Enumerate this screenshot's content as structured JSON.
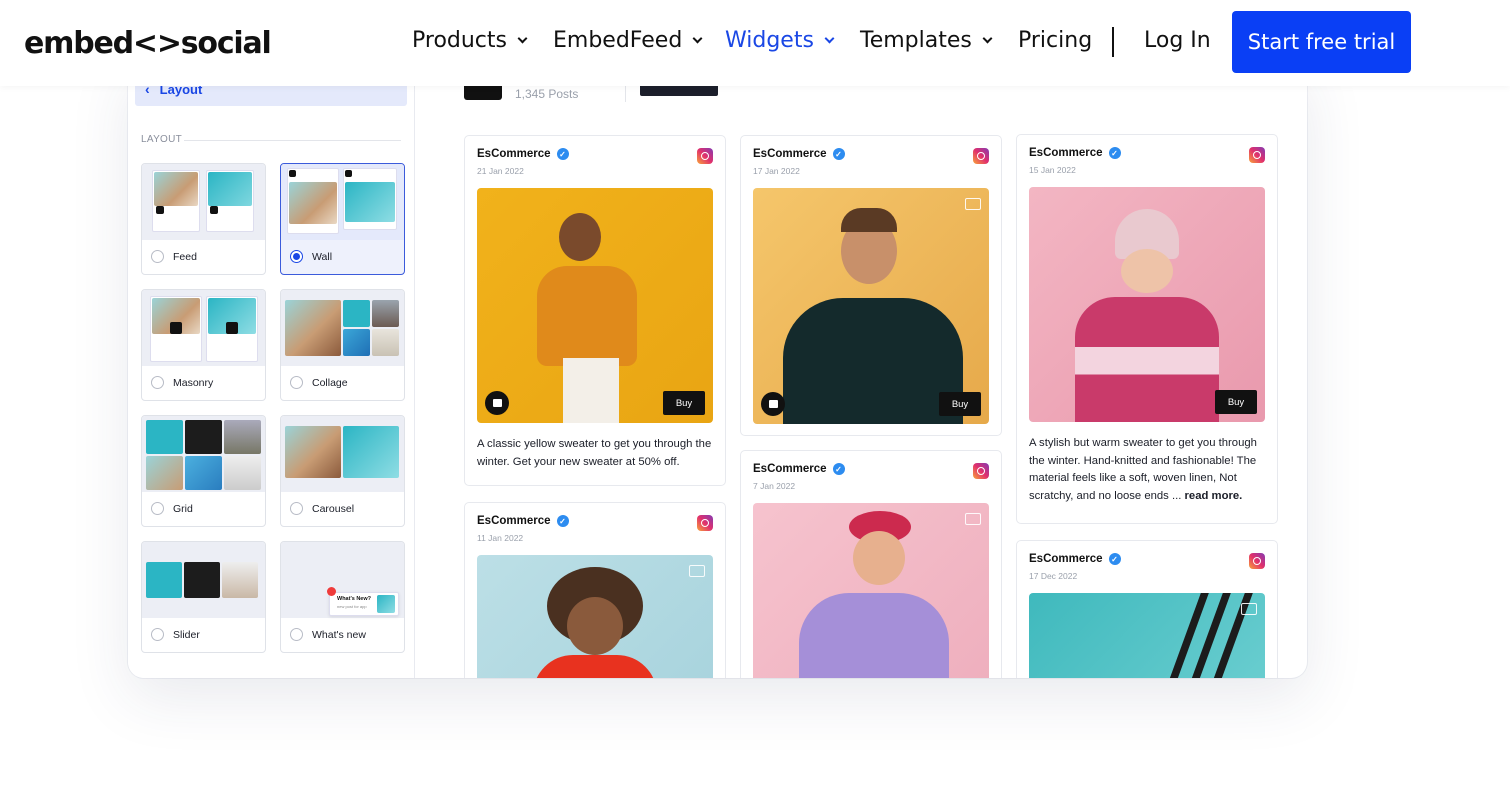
{
  "nav": {
    "logo": "embed<>social",
    "items": [
      {
        "label": "Products",
        "has_menu": true
      },
      {
        "label": "EmbedFeed",
        "has_menu": true
      },
      {
        "label": "Widgets",
        "has_menu": true,
        "active": true
      },
      {
        "label": "Templates",
        "has_menu": true
      },
      {
        "label": "Pricing",
        "has_menu": false
      }
    ],
    "login": "Log In",
    "cta": "Start free trial",
    "accent": "#0a3ff5"
  },
  "sidebar": {
    "back_label": "Layout",
    "section": "LAYOUT",
    "layouts": [
      {
        "label": "Feed",
        "selected": false
      },
      {
        "label": "Wall",
        "selected": true
      },
      {
        "label": "Masonry",
        "selected": false
      },
      {
        "label": "Collage",
        "selected": false
      },
      {
        "label": "Grid",
        "selected": false
      },
      {
        "label": "Carousel",
        "selected": false
      },
      {
        "label": "Slider",
        "selected": false
      },
      {
        "label": "What's new",
        "selected": false
      }
    ],
    "whats_new_popup": {
      "title": "What's New?",
      "sub": "new post for app"
    }
  },
  "header": {
    "posts_count": "1,345 Posts"
  },
  "posts": [
    {
      "author": "EsCommerce",
      "date": "21 Jan 2022",
      "buy": "Buy",
      "caption": "A classic yellow sweater to get you through the winter. Get your new sweater at 50% off.",
      "read_more": ""
    },
    {
      "author": "EsCommerce",
      "date": "17 Jan 2022",
      "buy": "Buy",
      "caption": "",
      "read_more": ""
    },
    {
      "author": "EsCommerce",
      "date": "15 Jan 2022",
      "buy": "Buy",
      "caption": "A stylish but warm sweater to get you through the winter. Hand-knitted and fashionable! The material feels like a soft, woven linen, Not scratchy, and no loose ends ...",
      "read_more": "read more."
    },
    {
      "author": "EsCommerce",
      "date": "11 Jan 2022",
      "buy": "",
      "caption": "",
      "read_more": ""
    },
    {
      "author": "EsCommerce",
      "date": "7 Jan 2022",
      "buy": "",
      "caption": "",
      "read_more": ""
    },
    {
      "author": "EsCommerce",
      "date": "17 Dec 2022",
      "buy": "",
      "caption": "",
      "read_more": ""
    }
  ]
}
